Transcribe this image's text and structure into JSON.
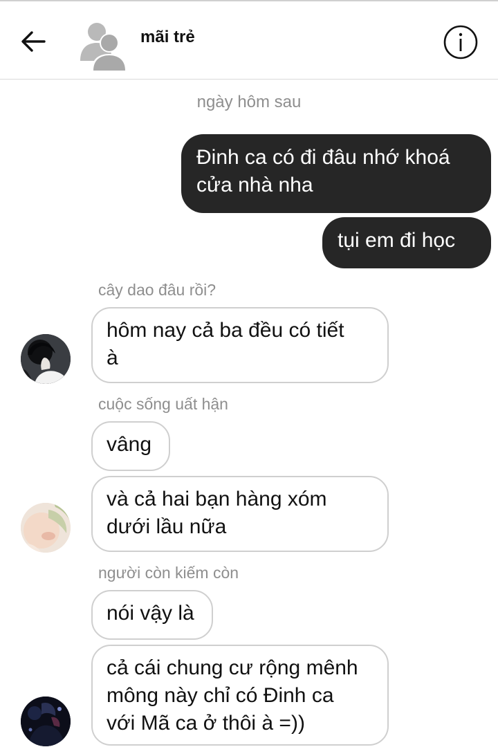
{
  "header": {
    "title": "mãi trẻ",
    "back_icon": "arrow-left-icon",
    "info_icon": "info-icon",
    "avatar_icon": "group-avatar-icon"
  },
  "chat": {
    "timestamp": "ngày hôm sau",
    "sent": [
      {
        "text": "Đinh ca có đi đâu nhớ khoá\ncửa nhà nha"
      },
      {
        "text": "tụi em đi học"
      }
    ],
    "groups": [
      {
        "sender": "cây dao đâu rồi?",
        "messages": [
          "hôm nay cả ba đều có tiết\nà"
        ]
      },
      {
        "sender": "cuộc sống uất hận",
        "messages": [
          "vâng",
          "và cả hai bạn hàng xóm\ndưới lầu nữa"
        ]
      },
      {
        "sender": "người còn kiếm còn",
        "messages": [
          "nói vậy là",
          "cả cái chung cư rộng mênh\nmông này chỉ có Đinh ca\nvới Mã ca ở thôi à =))"
        ]
      }
    ]
  },
  "colors": {
    "sent_bubble": "#262626",
    "received_border": "#cfcfcf",
    "meta_text": "#8e8e8e"
  }
}
